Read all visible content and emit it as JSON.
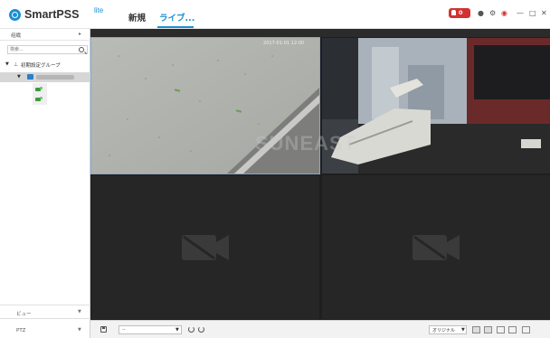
{
  "header": {
    "app_name": "SmartPSS",
    "app_suffix": "lite",
    "tab_new": "新規",
    "tab_live": "ライブ...",
    "alarm_count": "0"
  },
  "sidebar": {
    "org_label": "组織",
    "search_placeholder": "検索...",
    "group_label": "初期設定グループ",
    "view_label": "ビュー",
    "ptz_label": "PTZ"
  },
  "video": {
    "channel_label": "2017-01-01 12:00",
    "watermark": "SUNEAST"
  },
  "toolbar": {
    "window_select_value": "--",
    "original_label": "オリジナル"
  },
  "colors": {
    "accent": "#1a8fd6",
    "alarm": "#d23232"
  }
}
